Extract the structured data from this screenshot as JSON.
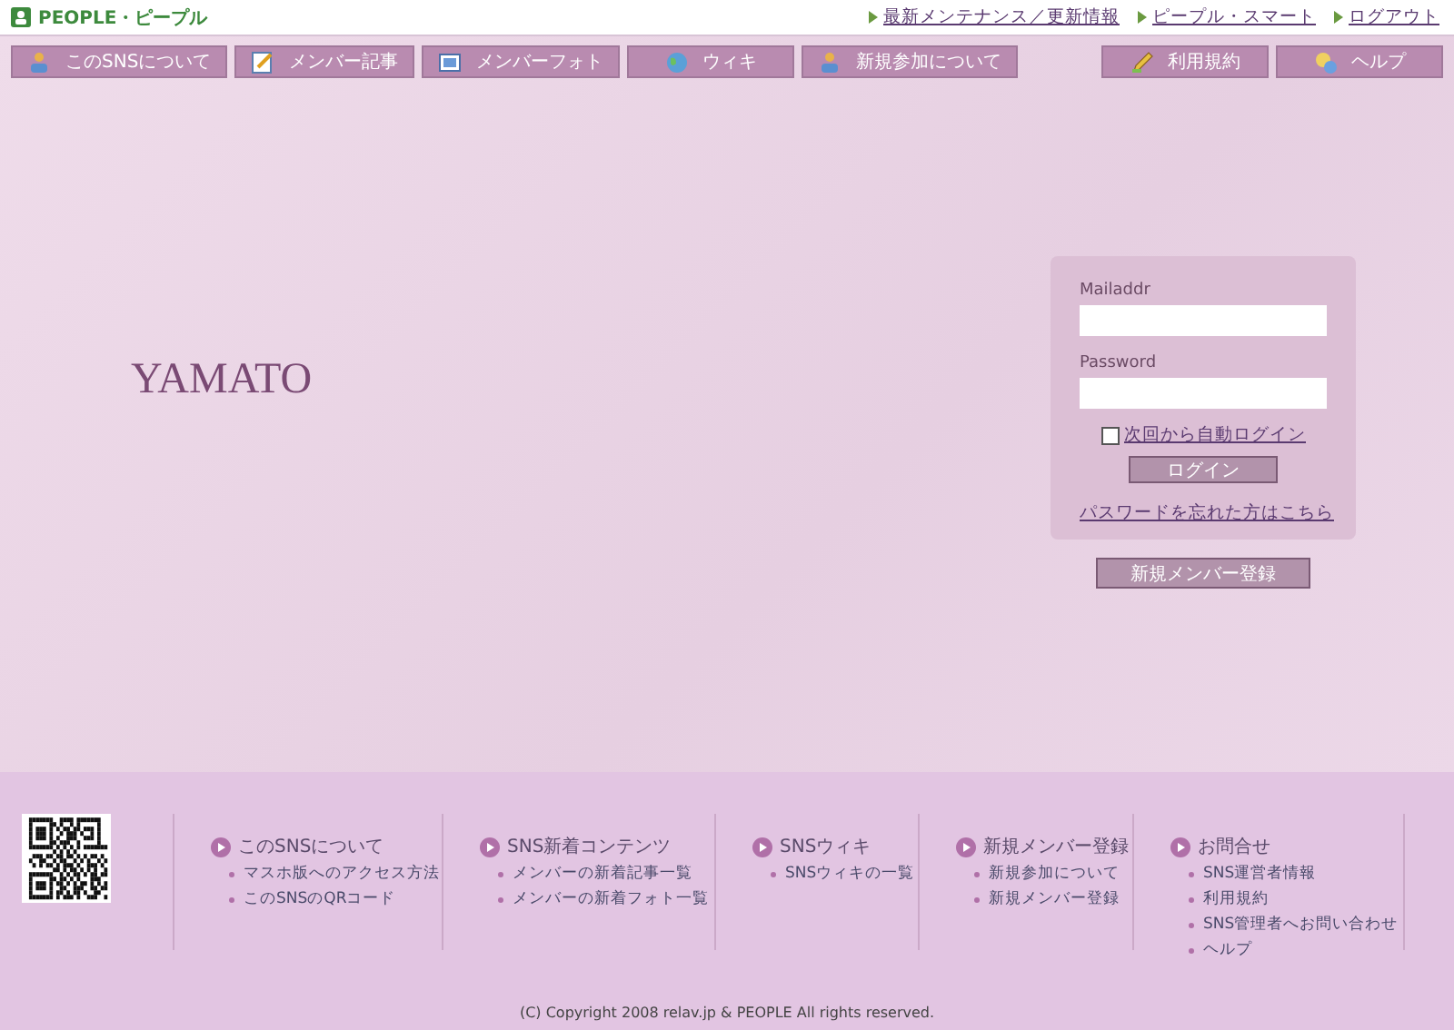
{
  "header": {
    "logo": "PEOPLE・ピープル",
    "links": [
      "最新メンテナンス／更新情報",
      "ピープル・スマート",
      "ログアウト"
    ]
  },
  "nav": {
    "left": [
      {
        "label": "このSNSについて"
      },
      {
        "label": "メンバー記事"
      },
      {
        "label": "メンバーフォト"
      },
      {
        "label": "ウィキ"
      },
      {
        "label": "新規参加について"
      }
    ],
    "right": [
      {
        "label": "利用規約"
      },
      {
        "label": "ヘルプ"
      }
    ]
  },
  "site_title": "YAMATO",
  "login": {
    "mail_label": "Mailaddr",
    "password_label": "Password",
    "auto_login": {
      "label": "次回から自動ログイン",
      "checked": false
    },
    "button": "ログイン",
    "forgot": "パスワードを忘れた方はこちら"
  },
  "register_button": "新規メンバー登録",
  "footer": {
    "columns": [
      {
        "title": "このSNSについて",
        "links": [
          "マスホ版へのアクセス方法",
          "このSNSのQRコード"
        ]
      },
      {
        "title": "SNS新着コンテンツ",
        "links": [
          "メンバーの新着記事一覧",
          "メンバーの新着フォト一覧"
        ]
      },
      {
        "title": "SNSウィキ",
        "links": [
          "SNSウィキの一覧"
        ]
      },
      {
        "title": "新規メンバー登録",
        "links": [
          "新規参加について",
          "新規メンバー登録"
        ]
      },
      {
        "title": "お問合せ",
        "links": [
          "SNS運営者情報",
          "利用規約",
          "SNS管理者へお問い合わせ",
          "ヘルプ"
        ]
      }
    ],
    "copyright": "(C) Copyright 2008 relav.jp & PEOPLE All rights reserved."
  }
}
